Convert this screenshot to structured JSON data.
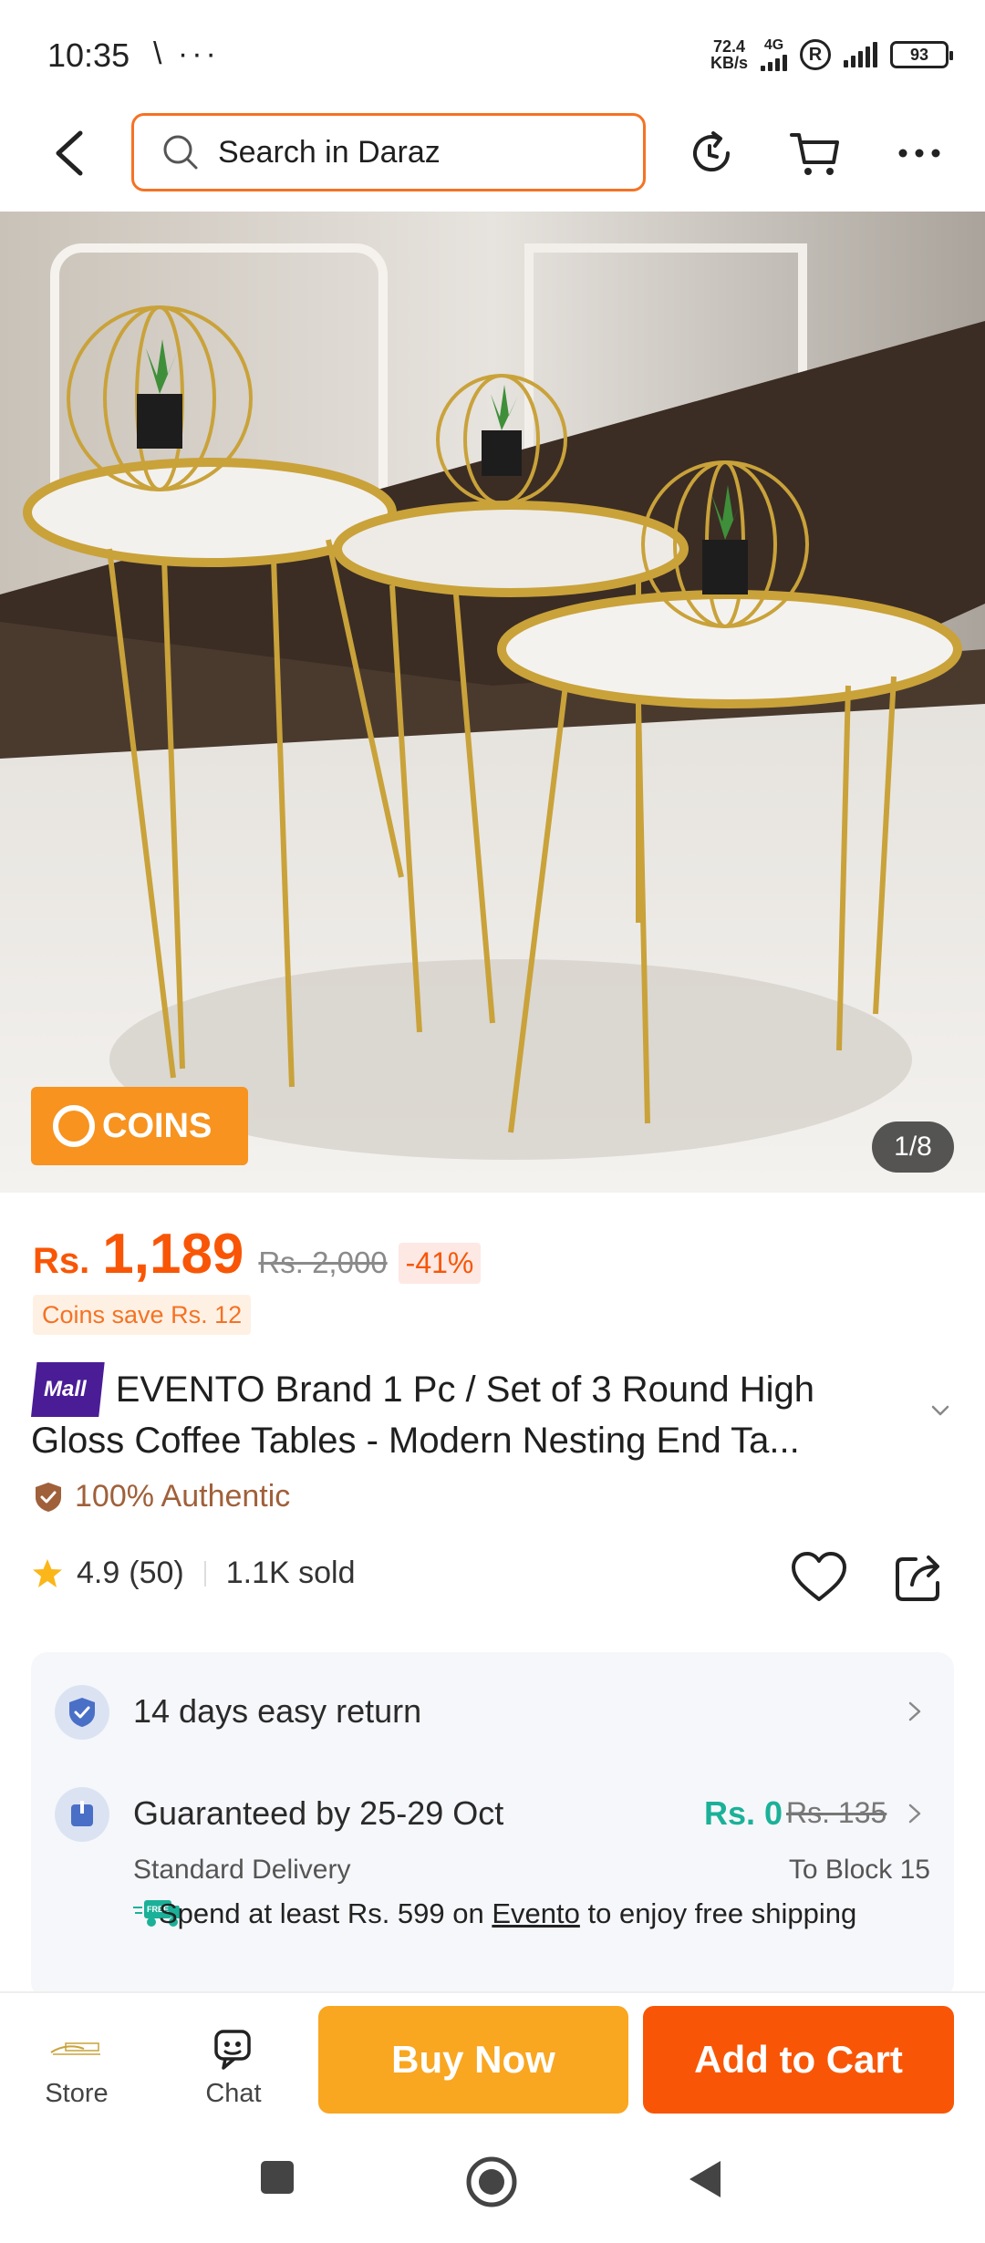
{
  "status_bar": {
    "time": "10:35",
    "left_icons": "\\ ···",
    "net_speed_value": "72.4",
    "net_speed_unit": "KB/s",
    "net_type": "4G",
    "registered": "R",
    "battery": "93"
  },
  "header": {
    "search_placeholder": "Search in Daraz",
    "icons": [
      "back-arrow-icon",
      "search-icon",
      "history-refresh-icon",
      "cart-icon",
      "more-icon"
    ]
  },
  "product_image": {
    "coins_badge": "COINS",
    "counter": "1/8"
  },
  "price": {
    "currency": "Rs.",
    "value": "1,189",
    "original": "Rs. 2,000",
    "discount": "-41%",
    "coins_save": "Coins save Rs. 12"
  },
  "product": {
    "mall_tag": "Mall",
    "title": "EVENTO Brand 1 Pc / Set of 3 Round High Gloss Coffee Tables - Modern Nesting End Ta...",
    "authentic": "100% Authentic",
    "rating": "4.9",
    "rating_count": "(50)",
    "sold": "1.1K sold"
  },
  "services": {
    "return_text": "14 days easy return",
    "delivery_title": "Guaranteed by 25-29 Oct",
    "delivery_fee": "Rs. 0",
    "delivery_fee_original": "Rs. 135",
    "delivery_type": "Standard Delivery",
    "delivery_location": "To Block 15",
    "free_tag": "FREE",
    "ship_note_prefix": "Spend at least Rs. 599 on ",
    "ship_note_store": "Evento",
    "ship_note_suffix": " to enjoy free shipping"
  },
  "bottom_bar": {
    "store_label": "Store",
    "chat_label": "Chat",
    "buy_now": "Buy Now",
    "add_to_cart": "Add to Cart"
  },
  "colors": {
    "brand_orange": "#f85606",
    "search_border": "#f57224",
    "buy_now": "#f9a620",
    "free_green": "#1bb199",
    "mall_purple": "#4a1d96"
  }
}
